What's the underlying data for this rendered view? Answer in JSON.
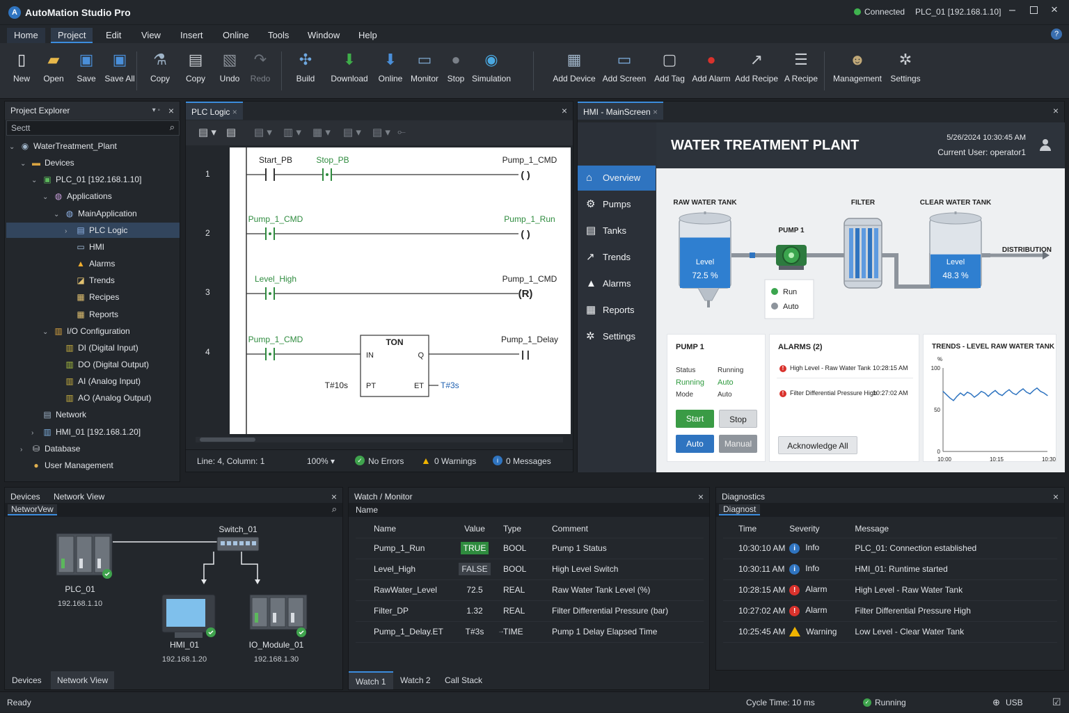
{
  "app": {
    "title": "AutoMation Studio Pro",
    "connection": "Connected",
    "target": "PLC_01 [192.168.1.10]",
    "help": "?"
  },
  "menu": [
    "Home",
    "Project",
    "Edit",
    "View",
    "Insert",
    "Online",
    "Tools",
    "Window",
    "Help"
  ],
  "toolbar": {
    "file": [
      {
        "label": "New",
        "icon": "new-file-icon"
      },
      {
        "label": "Open",
        "icon": "folder-icon"
      },
      {
        "label": "Save",
        "icon": "save-icon"
      },
      {
        "label": "Save All",
        "icon": "save-all-icon"
      }
    ],
    "edit": [
      {
        "label": "Copy",
        "icon": "copy-icon"
      },
      {
        "label": "Copy",
        "icon": "paste-icon"
      },
      {
        "label": "Undo",
        "icon": "undo-icon"
      },
      {
        "label": "Redo",
        "icon": "redo-icon"
      }
    ],
    "online": [
      {
        "label": "Build",
        "icon": "build-icon"
      },
      {
        "label": "Download",
        "icon": "download-icon"
      },
      {
        "label": "Online",
        "icon": "online-icon"
      },
      {
        "label": "Monitor",
        "icon": "monitor-icon"
      },
      {
        "label": "Stop",
        "icon": "stop-icon"
      },
      {
        "label": "Simulation",
        "icon": "simulation-icon"
      }
    ],
    "add": [
      {
        "label": "Add Device",
        "icon": "add-device-icon"
      },
      {
        "label": "Add Screen",
        "icon": "add-screen-icon"
      },
      {
        "label": "Add Tag",
        "icon": "add-tag-icon"
      },
      {
        "label": "Add Alarm",
        "icon": "add-alarm-icon"
      },
      {
        "label": "Add Recipe",
        "icon": "add-recipe-icon"
      },
      {
        "label": "A Recipe",
        "icon": "recipe-icon"
      }
    ],
    "admin": [
      {
        "label": "Management",
        "icon": "users-icon"
      },
      {
        "label": "Settings",
        "icon": "gear-icon"
      }
    ]
  },
  "explorer": {
    "title": "Project Explorer",
    "search_placeholder": "Sectt",
    "nodes": [
      {
        "label": "WaterTreatment_Plant",
        "indent": 0,
        "toggle": "⌄",
        "icon": "project-icon",
        "glyph": "◉",
        "color": "#9fb4c8"
      },
      {
        "label": "Devices",
        "indent": 1,
        "toggle": "⌄",
        "icon": "folder-icon",
        "glyph": "▬",
        "color": "#d9a441"
      },
      {
        "label": "PLC_01 [192.168.1.10]",
        "indent": 2,
        "toggle": "⌄",
        "icon": "plc-icon",
        "glyph": "▣",
        "color": "#5cb85c"
      },
      {
        "label": "Applications",
        "indent": 3,
        "toggle": "⌄",
        "icon": "applications-icon",
        "glyph": "◍",
        "color": "#c9a0dc"
      },
      {
        "label": "MainApplication",
        "indent": 4,
        "toggle": "⌄",
        "icon": "application-icon",
        "glyph": "◍",
        "color": "#8fb3e6"
      },
      {
        "label": "PLC Logic",
        "indent": 5,
        "toggle": "›",
        "icon": "logic-icon",
        "glyph": "▤",
        "color": "#8fb3e6",
        "selected": true
      },
      {
        "label": "HMI",
        "indent": 5,
        "toggle": "",
        "icon": "hmi-icon",
        "glyph": "▭",
        "color": "#a8c4e0"
      },
      {
        "label": "Alarms",
        "indent": 5,
        "toggle": "",
        "icon": "alarm-icon",
        "glyph": "▲",
        "color": "#f0ad2e"
      },
      {
        "label": "Trends",
        "indent": 5,
        "toggle": "",
        "icon": "trend-icon",
        "glyph": "◪",
        "color": "#e0c070"
      },
      {
        "label": "Recipes",
        "indent": 5,
        "toggle": "",
        "icon": "recipe-icon",
        "glyph": "▦",
        "color": "#e0c070"
      },
      {
        "label": "Reports",
        "indent": 5,
        "toggle": "",
        "icon": "report-icon",
        "glyph": "▦",
        "color": "#e0c070"
      },
      {
        "label": "I/O Configuration",
        "indent": 3,
        "toggle": "⌄",
        "icon": "io-icon",
        "glyph": "▥",
        "color": "#d9a441"
      },
      {
        "label": "DI (Digital Input)",
        "indent": 4,
        "toggle": "",
        "icon": "di-icon",
        "glyph": "▥",
        "color": "#c8b040"
      },
      {
        "label": "DO (Digital Output)",
        "indent": 4,
        "toggle": "",
        "icon": "do-icon",
        "glyph": "▥",
        "color": "#a8c040"
      },
      {
        "label": "AI (Analog Input)",
        "indent": 4,
        "toggle": "",
        "icon": "ai-icon",
        "glyph": "▥",
        "color": "#c8b040"
      },
      {
        "label": "AO (Analog Output)",
        "indent": 4,
        "toggle": "",
        "icon": "ao-icon",
        "glyph": "▥",
        "color": "#c8b040"
      },
      {
        "label": "Network",
        "indent": 2,
        "toggle": "",
        "icon": "network-icon",
        "glyph": "▤",
        "color": "#9fb4c8"
      },
      {
        "label": "HMI_01 [192.168.1.20]",
        "indent": 2,
        "toggle": "›",
        "icon": "hmi-device-icon",
        "glyph": "▥",
        "color": "#7fb0e0"
      },
      {
        "label": "Database",
        "indent": 1,
        "toggle": "›",
        "icon": "database-icon",
        "glyph": "⛁",
        "color": "#c8ccd1"
      },
      {
        "label": "User Management",
        "indent": 1,
        "toggle": "",
        "icon": "user-icon",
        "glyph": "●",
        "color": "#e0b050"
      }
    ]
  },
  "plc": {
    "tab": "PLC Logic",
    "rungs": [
      {
        "num": "1",
        "contacts": [
          "Start_PB",
          "Stop_PB"
        ],
        "coil": "Pump_1_CMD",
        "coil_sym": "( )"
      },
      {
        "num": "2",
        "contacts": [
          "Pump_1_CMD"
        ],
        "coil": "Pump_1_Run",
        "coil_sym": "( )"
      },
      {
        "num": "3",
        "contacts": [
          "Level_High"
        ],
        "coil": "Pump_1_CMD",
        "coil_sym": "(R)"
      },
      {
        "num": "4",
        "contacts": [
          "Pump_1_CMD"
        ],
        "coil": "Pump_1_Delay",
        "coil_sym": "| |"
      }
    ],
    "timer": {
      "name": "TON",
      "in": "IN",
      "q": "Q",
      "pt": "PT",
      "et": "ET",
      "preset": "T#10s",
      "elapsed": "T#3s"
    },
    "status": {
      "position": "Line: 4, Column: 1",
      "zoom": "100%",
      "errors": "No Errors",
      "warnings": "0 Warnings",
      "messages": "0 Messages"
    }
  },
  "hmi": {
    "tab": "HMI - MainScreen",
    "title": "WATER TREATMENT PLANT",
    "datetime": "5/26/2024  10:30:45 AM",
    "user": "Current User: operator1",
    "nav": [
      {
        "label": "Overview",
        "icon": "home-icon",
        "glyph": "⌂"
      },
      {
        "label": "Pumps",
        "icon": "pump-icon",
        "glyph": "⚙"
      },
      {
        "label": "Tanks",
        "icon": "tank-icon",
        "glyph": "▤"
      },
      {
        "label": "Trends",
        "icon": "trend-icon",
        "glyph": "↗"
      },
      {
        "label": "Alarms",
        "icon": "alarm-icon",
        "glyph": "▲"
      },
      {
        "label": "Reports",
        "icon": "report-icon",
        "glyph": "▦"
      },
      {
        "label": "Settings",
        "icon": "gear-icon",
        "glyph": "✲"
      }
    ],
    "process": {
      "raw_tank": "RAW WATER TANK",
      "raw_level_label": "Level",
      "raw_level": "72.5 %",
      "raw_fill": 0.725,
      "pump": "PUMP 1",
      "run": "Run",
      "auto": "Auto",
      "filter": "FILTER",
      "clear_tank": "CLEAR WATER TANK",
      "clear_level_label": "Level",
      "clear_level": "48.3 %",
      "clear_fill": 0.483,
      "distribution": "DISTRIBUTION"
    },
    "pump_card": {
      "title": "PUMP 1",
      "status_label": "Status",
      "status_value": "Running",
      "mode_label": "Mode",
      "mode_value": "Auto",
      "col2_status": "Running",
      "col2_mode": "Auto",
      "start": "Start",
      "stop": "Stop",
      "auto": "Auto",
      "manual": "Manual"
    },
    "alarms_card": {
      "title": "ALARMS (2)",
      "items": [
        {
          "text": "High Level - Raw Water Tank",
          "time": "10:28:15 AM"
        },
        {
          "text": "Filter Differential Pressure High",
          "time": "10:27:02 AM"
        }
      ],
      "ack": "Acknowledge All"
    },
    "trend_card": {
      "title": "TRENDS - LEVEL RAW WATER TANK"
    }
  },
  "chart_data": {
    "type": "line",
    "title": "TRENDS - LEVEL RAW WATER TANK",
    "ylabel": "%",
    "ylim": [
      0,
      100
    ],
    "yticks": [
      "100",
      "50",
      "0"
    ],
    "xticks": [
      "10:00",
      "10:15",
      "10:30"
    ],
    "x": [
      0,
      1,
      2,
      3,
      4,
      5,
      6,
      7,
      8,
      9,
      10,
      11,
      12,
      13,
      14,
      15,
      16,
      17,
      18,
      19,
      20,
      21,
      22,
      23,
      24,
      25,
      26,
      27,
      28,
      29,
      30
    ],
    "series": [
      {
        "values": [
          72,
          68,
          64,
          61,
          66,
          70,
          67,
          71,
          69,
          65,
          68,
          72,
          70,
          66,
          70,
          73,
          69,
          67,
          71,
          74,
          70,
          68,
          72,
          75,
          71,
          69,
          73,
          76,
          72,
          70,
          67
        ]
      }
    ]
  },
  "devices": {
    "tabs": [
      "Devices",
      "Network View"
    ],
    "sub_tab": "NetworVew",
    "nodes": [
      {
        "name": "PLC_01",
        "ip": "192.168.1.10"
      },
      {
        "name": "HMI_01",
        "ip": "192.168.1.20"
      },
      {
        "name": "IO_Module_01",
        "ip": "192.168.1.30"
      }
    ],
    "switch": "Switch_01",
    "bottom_tabs": [
      "Devices",
      "Network View"
    ]
  },
  "watch": {
    "title": "Watch / Monitor",
    "filter": "Name",
    "columns": [
      "Name",
      "Value",
      "Type",
      "Comment"
    ],
    "rows": [
      {
        "name": "Pump_1_Run",
        "value": "TRUE",
        "type": "BOOL",
        "comment": "Pump 1 Status",
        "badge": "true"
      },
      {
        "name": "Level_High",
        "value": "FALSE",
        "type": "BOOL",
        "comment": "High Level Switch",
        "badge": "false"
      },
      {
        "name": "RawWater_Level",
        "value": "72.5",
        "type": "REAL",
        "comment": "Raw Water Tank Level (%)",
        "badge": ""
      },
      {
        "name": "Filter_DP",
        "value": "1.32",
        "type": "REAL",
        "comment": "Filter Differential Pressure (bar)",
        "badge": ""
      },
      {
        "name": "Pump_1_Delay.ET",
        "value": "T#3s",
        "type": "TIME",
        "comment": "Pump 1 Delay Elapsed Time",
        "badge": "",
        "arrow": "→"
      }
    ],
    "tabs": [
      "Watch 1",
      "Watch 2",
      "Call Stack"
    ]
  },
  "diagnostics": {
    "title": "Diagnostics",
    "filter": "Diagnost",
    "columns": [
      "Time",
      "Severity",
      "Message"
    ],
    "rows": [
      {
        "time": "10:30:10 AM",
        "severity": "Info",
        "message": "PLC_01: Connection established",
        "kind": "info"
      },
      {
        "time": "10:30:11 AM",
        "severity": "Info",
        "message": "HMI_01: Runtime started",
        "kind": "info"
      },
      {
        "time": "10:28:15 AM",
        "severity": "Alarm",
        "message": "High Level - Raw Water Tank",
        "kind": "alarm"
      },
      {
        "time": "10:27:02 AM",
        "severity": "Alarm",
        "message": "Filter Differential Pressure High",
        "kind": "alarm"
      },
      {
        "time": "10:25:45 AM",
        "severity": "Warning",
        "message": "Low Level - Clear Water Tank",
        "kind": "warning"
      }
    ]
  },
  "statusbar": {
    "ready": "Ready",
    "cycle": "Cycle Time: 10 ms",
    "run": "Running",
    "usb": "USB"
  },
  "colors": {
    "accent": "#2f74c0",
    "ok": "#3fa34d",
    "alarm": "#d9322c",
    "warning": "#f0b400",
    "hmi_nav": "#2b3038"
  }
}
